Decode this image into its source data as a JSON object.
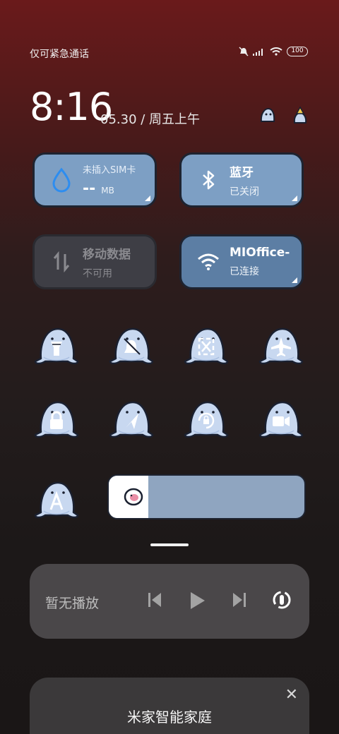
{
  "status_bar": {
    "carrier_text": "仅可紧急通话",
    "battery": "100"
  },
  "lockscreen": {
    "time": "8:16",
    "date": "05.30 / 周五上午"
  },
  "tiles": {
    "data": {
      "label": "未插入SIM卡",
      "value": "--",
      "unit": "MB"
    },
    "bluetooth": {
      "label": "蓝牙",
      "status": "已关闭"
    },
    "mobile": {
      "label": "移动数据",
      "status": "不可用"
    },
    "wifi": {
      "label": "MIOffice-",
      "status": "已连接"
    }
  },
  "toggles": [
    {
      "name": "flashlight",
      "icon": "flashlight-icon"
    },
    {
      "name": "mute",
      "icon": "bell-off-icon"
    },
    {
      "name": "screenshot",
      "icon": "scissors-icon"
    },
    {
      "name": "airplane",
      "icon": "airplane-icon"
    },
    {
      "name": "lock",
      "icon": "lock-icon"
    },
    {
      "name": "location",
      "icon": "location-icon"
    },
    {
      "name": "rotation-lock",
      "icon": "rotation-lock-icon"
    },
    {
      "name": "screen-record",
      "icon": "video-icon"
    },
    {
      "name": "auto-brightness",
      "icon": "a-icon"
    }
  ],
  "brightness": {
    "level": 0.2
  },
  "media": {
    "title": "暂无播放"
  },
  "home_card": {
    "title": "米家智能家庭",
    "subtitle": ""
  },
  "colors": {
    "tile_active": "#7d9fc4",
    "tile_disabled": "#3e3e45",
    "mascot_body": "#c8d8f0"
  }
}
